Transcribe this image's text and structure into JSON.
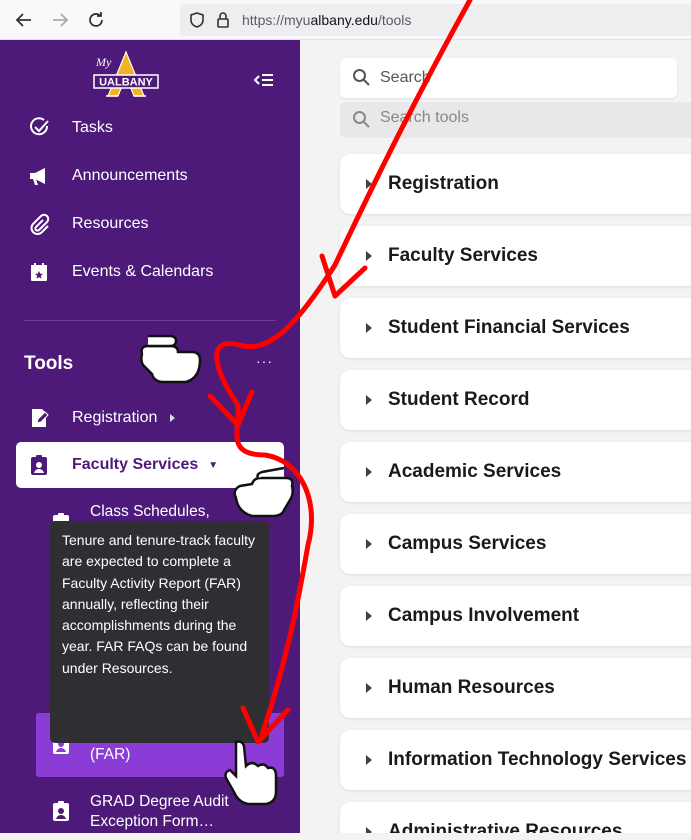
{
  "browser": {
    "url_prefix": "https://myu",
    "url_domain": "albany.edu",
    "url_path": "/tools",
    "back_icon": "arrow-left-icon",
    "forward_icon": "arrow-right-icon",
    "reload_icon": "reload-icon"
  },
  "sidebar": {
    "logo_my": "My",
    "logo_name": "UALBANY",
    "nav": [
      {
        "label": "Tasks",
        "icon": "check-circle-icon"
      },
      {
        "label": "Announcements",
        "icon": "megaphone-icon"
      },
      {
        "label": "Resources",
        "icon": "paperclip-icon"
      },
      {
        "label": "Events & Calendars",
        "icon": "calendar-star-icon"
      }
    ],
    "tools_heading": "Tools",
    "tools_more": "···",
    "tools": {
      "registration": "Registration",
      "faculty_services": "Faculty Services",
      "class_schedules": "Class Schedules,",
      "far": "Faculty Activity Reports (FAR)",
      "grad": "GRAD Degree Audit Exception Form…"
    },
    "tooltip": "Tenure and tenure-track faculty are expected to complete a Faculty Activity Report (FAR) annually, reflecting their accomplishments during the year. FAR FAQs can be found under Resources."
  },
  "main": {
    "search_placeholder": "Search",
    "search_tools_placeholder": "Search tools",
    "categories": [
      "Registration",
      "Faculty Services",
      "Student Financial Services",
      "Student Record",
      "Academic Services",
      "Campus Services",
      "Campus Involvement",
      "Human Resources",
      "Information Technology Services",
      "Administrative Resources"
    ]
  },
  "colors": {
    "sidebar_bg": "#4e1a7a",
    "selected_bg": "#8c3cd6",
    "logo_gold": "#f0b324",
    "annotation_red": "#ff0000"
  }
}
